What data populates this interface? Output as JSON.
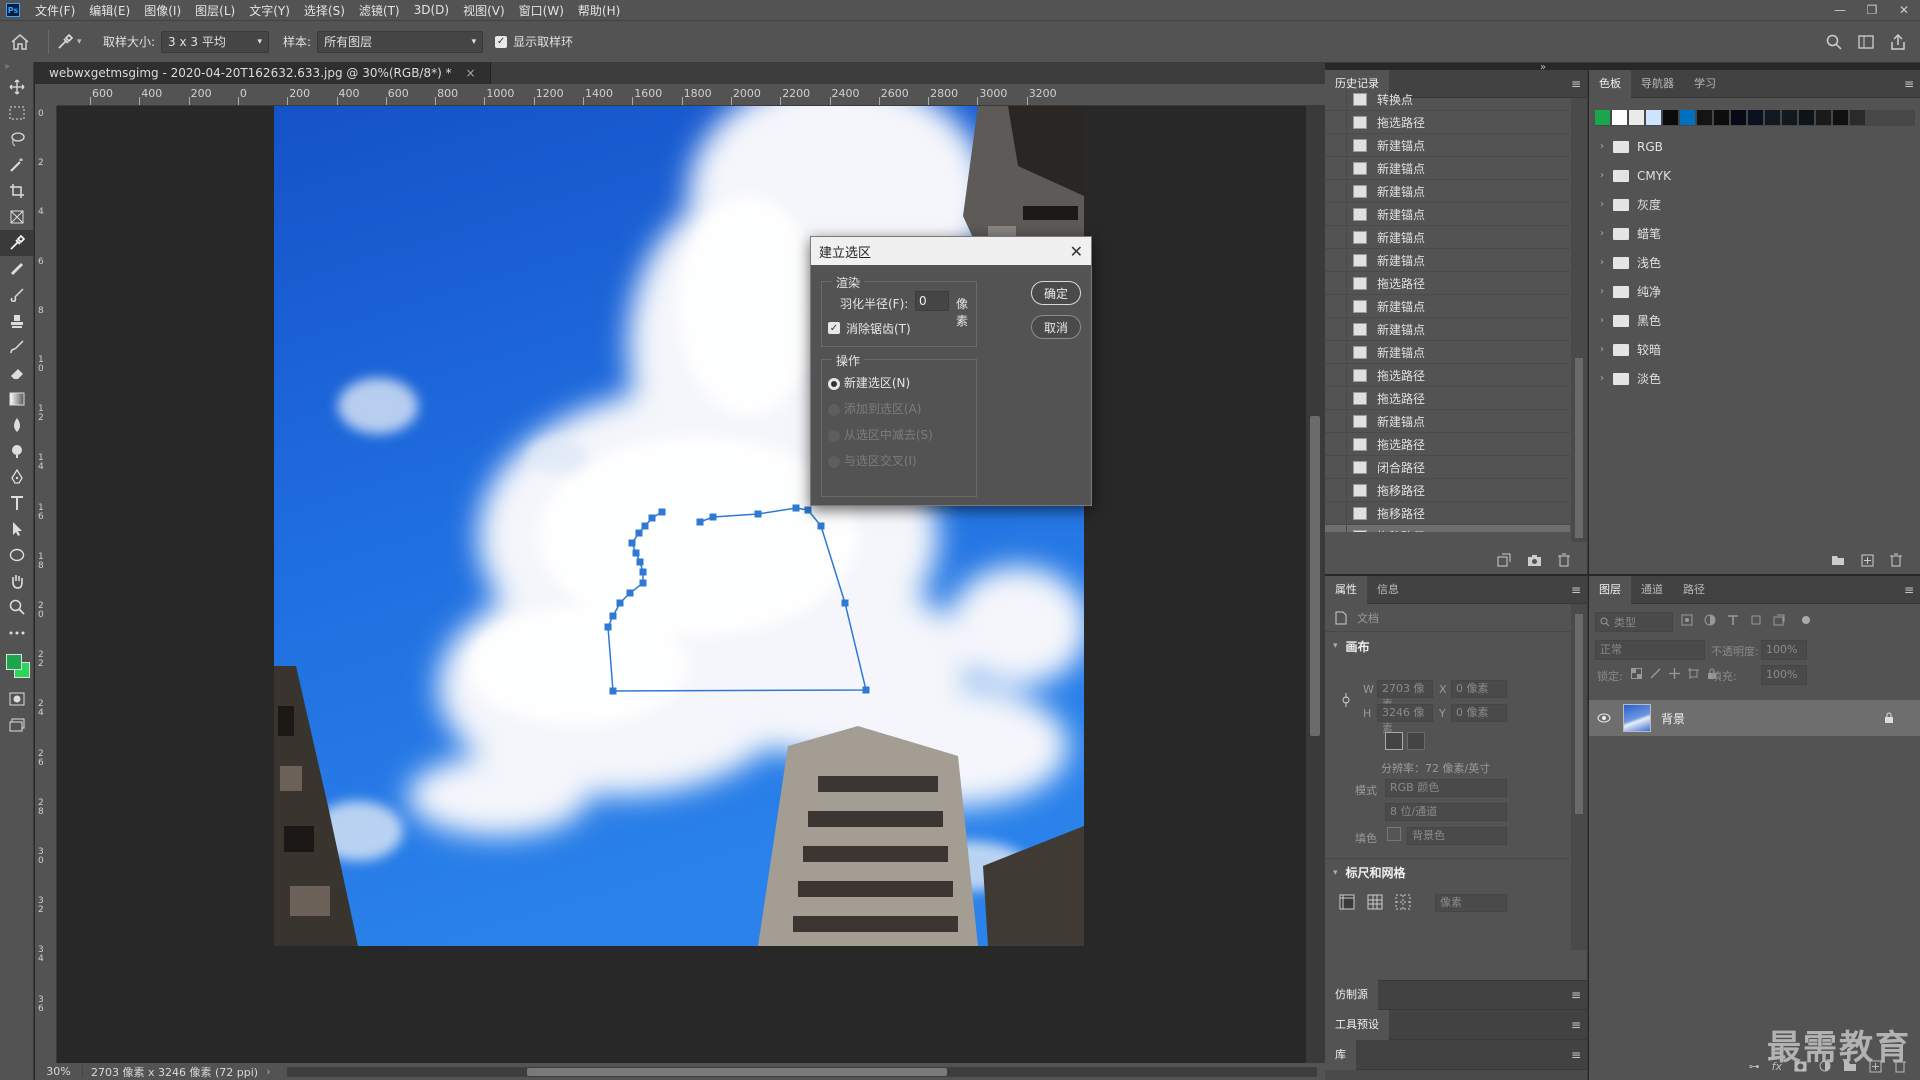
{
  "app": {
    "logo": "Ps"
  },
  "menu": [
    "文件(F)",
    "编辑(E)",
    "图像(I)",
    "图层(L)",
    "文字(Y)",
    "选择(S)",
    "滤镜(T)",
    "3D(D)",
    "视图(V)",
    "窗口(W)",
    "帮助(H)"
  ],
  "window_controls": [
    "—",
    "❐",
    "✕"
  ],
  "options": {
    "sample_size_label": "取样大小:",
    "sample_size_value": "3 x 3 平均",
    "sample_label": "样本:",
    "sample_value": "所有图层",
    "show_ring_label": "显示取样环",
    "show_ring_checked": true
  },
  "document": {
    "tab_title": "webwxgetmsgimg - 2020-04-20T162632.633.jpg @ 30%(RGB/8*) *",
    "ruler_ticks": [
      "600",
      "400",
      "200",
      "0",
      "200",
      "400",
      "600",
      "800",
      "1000",
      "1200",
      "1400",
      "1600",
      "1800",
      "2000",
      "2200",
      "2400",
      "2600",
      "2800",
      "3000",
      "3200"
    ],
    "ruler_v_ticks": [
      "0",
      "2",
      "4",
      "6",
      "8",
      "1 0",
      "1 2",
      "1 4",
      "1 6",
      "1 8",
      "2 0",
      "2 2",
      "2 4",
      "2 6",
      "2 8",
      "3 0",
      "3 2",
      "3 4",
      "3 6"
    ]
  },
  "status": {
    "zoom": "30%",
    "info": "2703 像素 x 3246 像素 (72 ppi)"
  },
  "dialog": {
    "title": "建立选区",
    "render_group": "渲染",
    "feather_label": "羽化半径(F):",
    "feather_value": "0",
    "feather_unit": "像素",
    "antialias_label": "消除锯齿(T)",
    "antialias_checked": true,
    "ops_group": "操作",
    "ops": [
      {
        "label": "新建选区(N)",
        "selected": true,
        "enabled": true
      },
      {
        "label": "添加到选区(A)",
        "selected": false,
        "enabled": false
      },
      {
        "label": "从选区中减去(S)",
        "selected": false,
        "enabled": false
      },
      {
        "label": "与选区交叉(I)",
        "selected": false,
        "enabled": false
      }
    ],
    "ok": "确定",
    "cancel": "取消"
  },
  "history": {
    "tab": "历史记录",
    "items": [
      "转换点",
      "拖选路径",
      "新建锚点",
      "新建锚点",
      "新建锚点",
      "新建锚点",
      "新建锚点",
      "新建锚点",
      "拖选路径",
      "新建锚点",
      "新建锚点",
      "新建锚点",
      "拖选路径",
      "拖选路径",
      "新建锚点",
      "拖选路径",
      "闭合路径",
      "拖移路径",
      "拖移路径",
      "拖移路径"
    ],
    "selected_index": 19
  },
  "swatches": {
    "tabs": [
      "色板",
      "导航器",
      "学习"
    ],
    "colors": [
      "#1aa64b",
      "#ffffff",
      "#eaeaea",
      "#cde3ff",
      "#0b0b0b",
      "#0070c0",
      "#141414",
      "#0d0d0d",
      "#050a16",
      "#0c1120",
      "#111820",
      "#12191f",
      "#0e1318",
      "#1a1a1a",
      "#111111",
      "#2a2a2a"
    ],
    "folders": [
      "RGB",
      "CMYK",
      "灰度",
      "蜡笔",
      "浅色",
      "纯净",
      "黑色",
      "较暗",
      "淡色"
    ]
  },
  "properties": {
    "tabs": [
      "属性",
      "信息"
    ],
    "doc_label": "文档",
    "canvas_section": "画布",
    "w_label": "W",
    "w_value": "2703 像素",
    "h_label": "H",
    "h_value": "3246 像素",
    "x_label": "X",
    "x_value": "0 像素",
    "y_label": "Y",
    "y_value": "0 像素",
    "resolution": "分辨率：72 像素/英寸",
    "mode_label": "模式",
    "mode_value": "RGB 颜色",
    "depth_value": "8 位/通道",
    "fill_label": "填色",
    "fill_value": "背景色",
    "rulers_section": "标尺和网格",
    "units_value": "像素"
  },
  "layers": {
    "tabs": [
      "图层",
      "通道",
      "路径"
    ],
    "filter_placeholder": "类型",
    "blend_mode": "正常",
    "opacity_label": "不透明度:",
    "opacity_value": "100%",
    "lock_label": "锁定:",
    "fill_label": "填充:",
    "fill_value": "100%",
    "items": [
      {
        "name": "背景",
        "visible": true,
        "locked": true
      }
    ]
  },
  "collapsed_panels": [
    "仿制源",
    "工具预设",
    "库"
  ],
  "watermark": "最需教育"
}
